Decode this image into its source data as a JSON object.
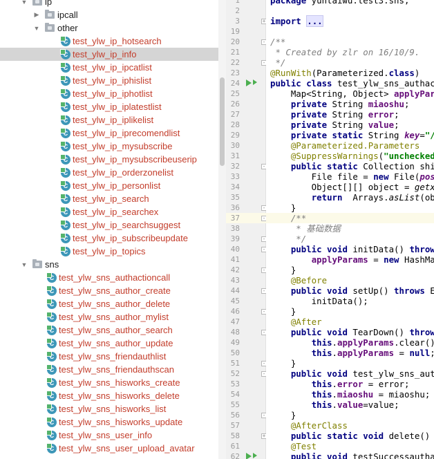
{
  "tree": {
    "folders": [
      {
        "label": "ip",
        "expanded": true
      },
      {
        "label": "ipcall",
        "expanded": false
      },
      {
        "label": "other",
        "expanded": true
      },
      {
        "label": "sns",
        "expanded": true
      }
    ],
    "ip_other_classes": [
      "test_ylw_ip_hotsearch",
      "test_ylw_ip_info",
      "test_ylw_ip_ipcatlist",
      "test_ylw_ip_iphislist",
      "test_ylw_ip_iphotlist",
      "test_ylw_ip_iplatestlist",
      "test_ylw_ip_iplikelist",
      "test_ylw_ip_iprecomendlist",
      "test_ylw_ip_mysubscribe",
      "test_ylw_ip_mysubscribeuserip",
      "test_ylw_ip_orderzonelist",
      "test_ylw_ip_personlist",
      "test_ylw_ip_search",
      "test_ylw_ip_searchex",
      "test_ylw_ip_searchsuggest",
      "test_ylw_ip_subscribeupdate",
      "test_ylw_ip_topics"
    ],
    "sns_classes": [
      "test_ylw_sns_authactioncall",
      "test_ylw_sns_author_create",
      "test_ylw_sns_author_delete",
      "test_ylw_sns_author_mylist",
      "test_ylw_sns_author_search",
      "test_ylw_sns_author_update",
      "test_ylw_sns_friendauthlist",
      "test_ylw_sns_friendauthscan",
      "test_ylw_sns_hisworks_create",
      "test_ylw_sns_hisworks_delete",
      "test_ylw_sns_hisworks_list",
      "test_ylw_sns_hisworks_update",
      "test_ylw_sns_user_info",
      "test_ylw_sns_user_upload_avatar"
    ],
    "selected": "test_ylw_ip_info",
    "class_icon_letter": "C"
  },
  "editor": {
    "current_line": "37",
    "lines": [
      {
        "n": "1",
        "tokens": [
          [
            "kw",
            "package"
          ],
          [
            "plain",
            " yuntaiwu.test3.sns;"
          ]
        ]
      },
      {
        "n": "2",
        "tokens": []
      },
      {
        "n": "3",
        "fold": "+",
        "tokens": [
          [
            "kw",
            "import"
          ],
          [
            "plain",
            " "
          ],
          [
            "fold",
            "..."
          ]
        ]
      },
      {
        "n": "19",
        "tokens": []
      },
      {
        "n": "20",
        "fold": "-",
        "tokens": [
          [
            "cmt",
            "/**"
          ]
        ]
      },
      {
        "n": "21",
        "tokens": [
          [
            "cmt",
            " * Created by zlr on 16/10/9."
          ]
        ]
      },
      {
        "n": "22",
        "fold": "-",
        "tokens": [
          [
            "cmt",
            " */"
          ]
        ]
      },
      {
        "n": "23",
        "tokens": [
          [
            "ann",
            "@RunWith"
          ],
          [
            "plain",
            "(Parameterized."
          ],
          [
            "kw",
            "class"
          ],
          [
            "plain",
            ")"
          ]
        ]
      },
      {
        "n": "24",
        "run": true,
        "tokens": [
          [
            "kw",
            "public class"
          ],
          [
            "plain",
            " test_ylw_sns_authactic"
          ]
        ]
      },
      {
        "n": "25",
        "tokens": [
          [
            "plain",
            "    Map<String, Object> "
          ],
          [
            "fld",
            "applyParam"
          ]
        ]
      },
      {
        "n": "26",
        "tokens": [
          [
            "plain",
            "    "
          ],
          [
            "kw",
            "private"
          ],
          [
            "plain",
            " String "
          ],
          [
            "fld",
            "miaoshu"
          ],
          [
            "plain",
            ";"
          ]
        ]
      },
      {
        "n": "27",
        "tokens": [
          [
            "plain",
            "    "
          ],
          [
            "kw",
            "private"
          ],
          [
            "plain",
            " String "
          ],
          [
            "fld",
            "error"
          ],
          [
            "plain",
            ";"
          ]
        ]
      },
      {
        "n": "28",
        "tokens": [
          [
            "plain",
            "    "
          ],
          [
            "kw",
            "private"
          ],
          [
            "plain",
            " String "
          ],
          [
            "fld",
            "value"
          ],
          [
            "plain",
            ";"
          ]
        ]
      },
      {
        "n": "29",
        "tokens": [
          [
            "plain",
            "    "
          ],
          [
            "kw",
            "private static"
          ],
          [
            "plain",
            " String "
          ],
          [
            "statfld",
            "key"
          ],
          [
            "plain",
            "="
          ],
          [
            "str",
            "\"/sn"
          ]
        ]
      },
      {
        "n": "30",
        "tokens": [
          [
            "plain",
            "    "
          ],
          [
            "ann",
            "@Parameterized.Parameters"
          ]
        ]
      },
      {
        "n": "31",
        "tokens": [
          [
            "plain",
            "    "
          ],
          [
            "ann",
            "@SuppressWarnings"
          ],
          [
            "plain",
            "("
          ],
          [
            "str",
            "\"unchecked\""
          ],
          [
            "plain",
            ")"
          ]
        ]
      },
      {
        "n": "32",
        "fold": "-",
        "tokens": [
          [
            "plain",
            "    "
          ],
          [
            "kw",
            "public static"
          ],
          [
            "plain",
            " Collection shiya"
          ]
        ]
      },
      {
        "n": "33",
        "tokens": [
          [
            "plain",
            "        File file = "
          ],
          [
            "kw",
            "new"
          ],
          [
            "plain",
            " File("
          ],
          [
            "statfld",
            "postx"
          ]
        ]
      },
      {
        "n": "34",
        "tokens": [
          [
            "plain",
            "        Object[][] object = "
          ],
          [
            "stat",
            "getxls"
          ]
        ]
      },
      {
        "n": "35",
        "tokens": [
          [
            "plain",
            "        "
          ],
          [
            "kw",
            "return"
          ],
          [
            "plain",
            "  Arrays."
          ],
          [
            "stat",
            "asList"
          ],
          [
            "plain",
            "(obje"
          ]
        ]
      },
      {
        "n": "36",
        "fold": "-",
        "tokens": [
          [
            "plain",
            "    }"
          ]
        ]
      },
      {
        "n": "37",
        "fold": "-",
        "tokens": [
          [
            "plain",
            "    "
          ],
          [
            "cmt",
            "/**"
          ]
        ]
      },
      {
        "n": "38",
        "tokens": [
          [
            "cmt",
            "     * 基础数据"
          ]
        ]
      },
      {
        "n": "39",
        "fold": "-",
        "tokens": [
          [
            "cmt",
            "     */"
          ]
        ]
      },
      {
        "n": "40",
        "fold": "-",
        "tokens": [
          [
            "plain",
            "    "
          ],
          [
            "kw",
            "public void"
          ],
          [
            "plain",
            " initData() "
          ],
          [
            "kw",
            "throws"
          ]
        ]
      },
      {
        "n": "41",
        "tokens": [
          [
            "plain",
            "        "
          ],
          [
            "fld",
            "applyParams"
          ],
          [
            "plain",
            " = "
          ],
          [
            "kw",
            "new"
          ],
          [
            "plain",
            " HashMap<"
          ]
        ]
      },
      {
        "n": "42",
        "fold": "-",
        "tokens": [
          [
            "plain",
            "    }"
          ]
        ]
      },
      {
        "n": "43",
        "tokens": [
          [
            "plain",
            "    "
          ],
          [
            "ann",
            "@Before"
          ]
        ]
      },
      {
        "n": "44",
        "fold": "-",
        "tokens": [
          [
            "plain",
            "    "
          ],
          [
            "kw",
            "public void"
          ],
          [
            "plain",
            " setUp() "
          ],
          [
            "kw",
            "throws"
          ],
          [
            "plain",
            " Exc"
          ]
        ]
      },
      {
        "n": "45",
        "tokens": [
          [
            "plain",
            "        initData();"
          ]
        ]
      },
      {
        "n": "46",
        "fold": "-",
        "tokens": [
          [
            "plain",
            "    }"
          ]
        ]
      },
      {
        "n": "47",
        "tokens": [
          [
            "plain",
            "    "
          ],
          [
            "ann",
            "@After"
          ]
        ]
      },
      {
        "n": "48",
        "fold": "-",
        "tokens": [
          [
            "plain",
            "    "
          ],
          [
            "kw",
            "public void"
          ],
          [
            "plain",
            " TearDown() "
          ],
          [
            "kw",
            "throws"
          ]
        ]
      },
      {
        "n": "49",
        "tokens": [
          [
            "plain",
            "        "
          ],
          [
            "kw",
            "this"
          ],
          [
            "plain",
            "."
          ],
          [
            "fld",
            "applyParams"
          ],
          [
            "plain",
            ".clear();"
          ]
        ]
      },
      {
        "n": "50",
        "tokens": [
          [
            "plain",
            "        "
          ],
          [
            "kw",
            "this"
          ],
          [
            "plain",
            "."
          ],
          [
            "fld",
            "applyParams"
          ],
          [
            "plain",
            " = "
          ],
          [
            "kw",
            "null"
          ],
          [
            "plain",
            ";"
          ]
        ]
      },
      {
        "n": "51",
        "fold": "-",
        "tokens": [
          [
            "plain",
            "    }"
          ]
        ]
      },
      {
        "n": "52",
        "fold": "-",
        "tokens": [
          [
            "plain",
            "    "
          ],
          [
            "kw",
            "public void"
          ],
          [
            "plain",
            " test_ylw_sns_authaction"
          ]
        ]
      },
      {
        "n": "53",
        "tokens": [
          [
            "plain",
            "        "
          ],
          [
            "kw",
            "this"
          ],
          [
            "plain",
            "."
          ],
          [
            "fld",
            "error"
          ],
          [
            "plain",
            " = error;"
          ]
        ]
      },
      {
        "n": "54",
        "tokens": [
          [
            "plain",
            "        "
          ],
          [
            "kw",
            "this"
          ],
          [
            "plain",
            "."
          ],
          [
            "fld",
            "miaoshu"
          ],
          [
            "plain",
            " = miaoshu;"
          ]
        ]
      },
      {
        "n": "55",
        "tokens": [
          [
            "plain",
            "        "
          ],
          [
            "kw",
            "this"
          ],
          [
            "plain",
            "."
          ],
          [
            "fld",
            "value"
          ],
          [
            "plain",
            "=value;"
          ]
        ]
      },
      {
        "n": "56",
        "fold": "-",
        "tokens": [
          [
            "plain",
            "    }"
          ]
        ]
      },
      {
        "n": "57",
        "tokens": [
          [
            "plain",
            "    "
          ],
          [
            "ann",
            "@AfterClass"
          ]
        ]
      },
      {
        "n": "58",
        "fold": "+",
        "tokens": [
          [
            "plain",
            "    "
          ],
          [
            "kw",
            "public static void"
          ],
          [
            "plain",
            " delete() {"
          ]
        ]
      },
      {
        "n": "61",
        "tokens": [
          [
            "plain",
            "    "
          ],
          [
            "ann",
            "@Test"
          ]
        ]
      },
      {
        "n": "62",
        "run": true,
        "tokens": [
          [
            "plain",
            "    "
          ],
          [
            "kw",
            "public void"
          ],
          [
            "plain",
            " testSuccessauthact"
          ]
        ]
      }
    ]
  }
}
